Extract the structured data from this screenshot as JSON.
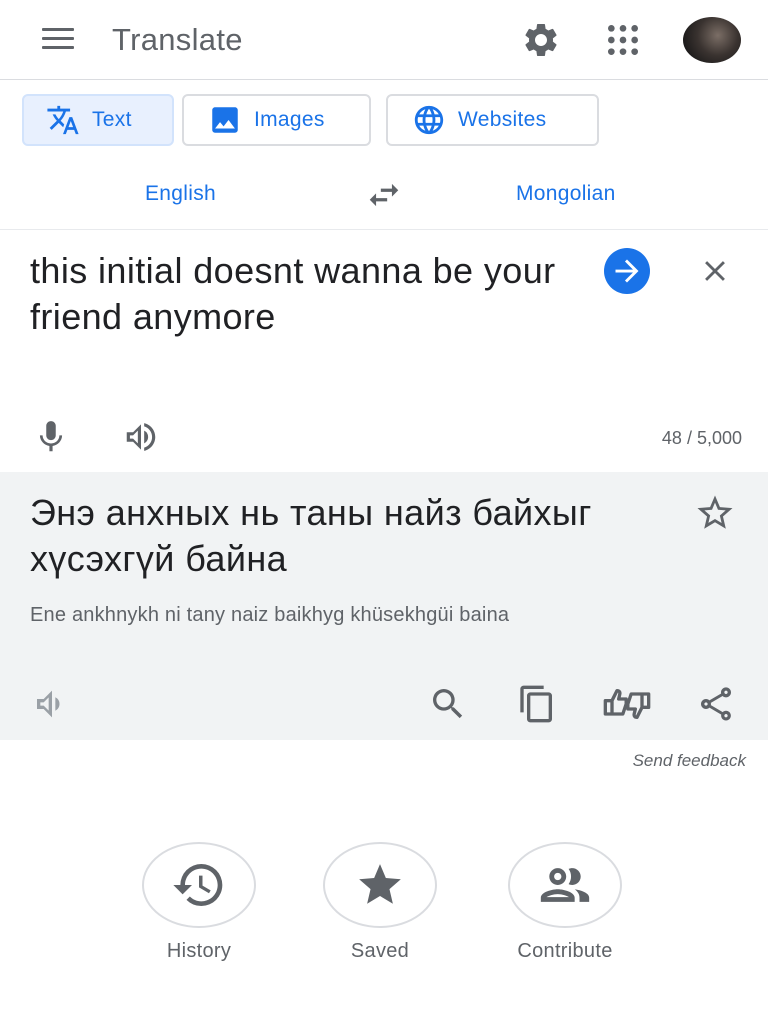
{
  "app": {
    "title": "Translate"
  },
  "header": {
    "menu_icon": "hamburger-menu-icon",
    "settings_icon": "gear-icon",
    "apps_icon": "apps-grid-icon",
    "avatar_icon": "user-avatar"
  },
  "modes": [
    {
      "label": "Text",
      "icon": "translate-icon",
      "active": true
    },
    {
      "label": "Images",
      "icon": "image-icon",
      "active": false
    },
    {
      "label": "Websites",
      "icon": "globe-icon",
      "active": false
    }
  ],
  "languages": {
    "source": "English",
    "target": "Mongolian",
    "swap_icon": "swap-arrows-icon"
  },
  "source": {
    "text": "this initial doesnt wanna be your friend anymore",
    "char_count": "48 / 5,000"
  },
  "result": {
    "text": "Энэ анхных нь таны найз байхыг хүсэхгүй байна",
    "transliteration": "Ene ankhnykh ni tany naiz baikhyg khüsekhgüi baina"
  },
  "feedback": {
    "label": "Send feedback"
  },
  "bottom_nav": [
    {
      "label": "History",
      "icon": "history-icon"
    },
    {
      "label": "Saved",
      "icon": "star-filled-icon"
    },
    {
      "label": "Contribute",
      "icon": "people-icon"
    }
  ],
  "colors": {
    "accent": "#1a73e8",
    "icon_gray": "#5f6368",
    "result_bg": "#f1f3f4",
    "active_mode_bg": "#e8f0fe"
  }
}
